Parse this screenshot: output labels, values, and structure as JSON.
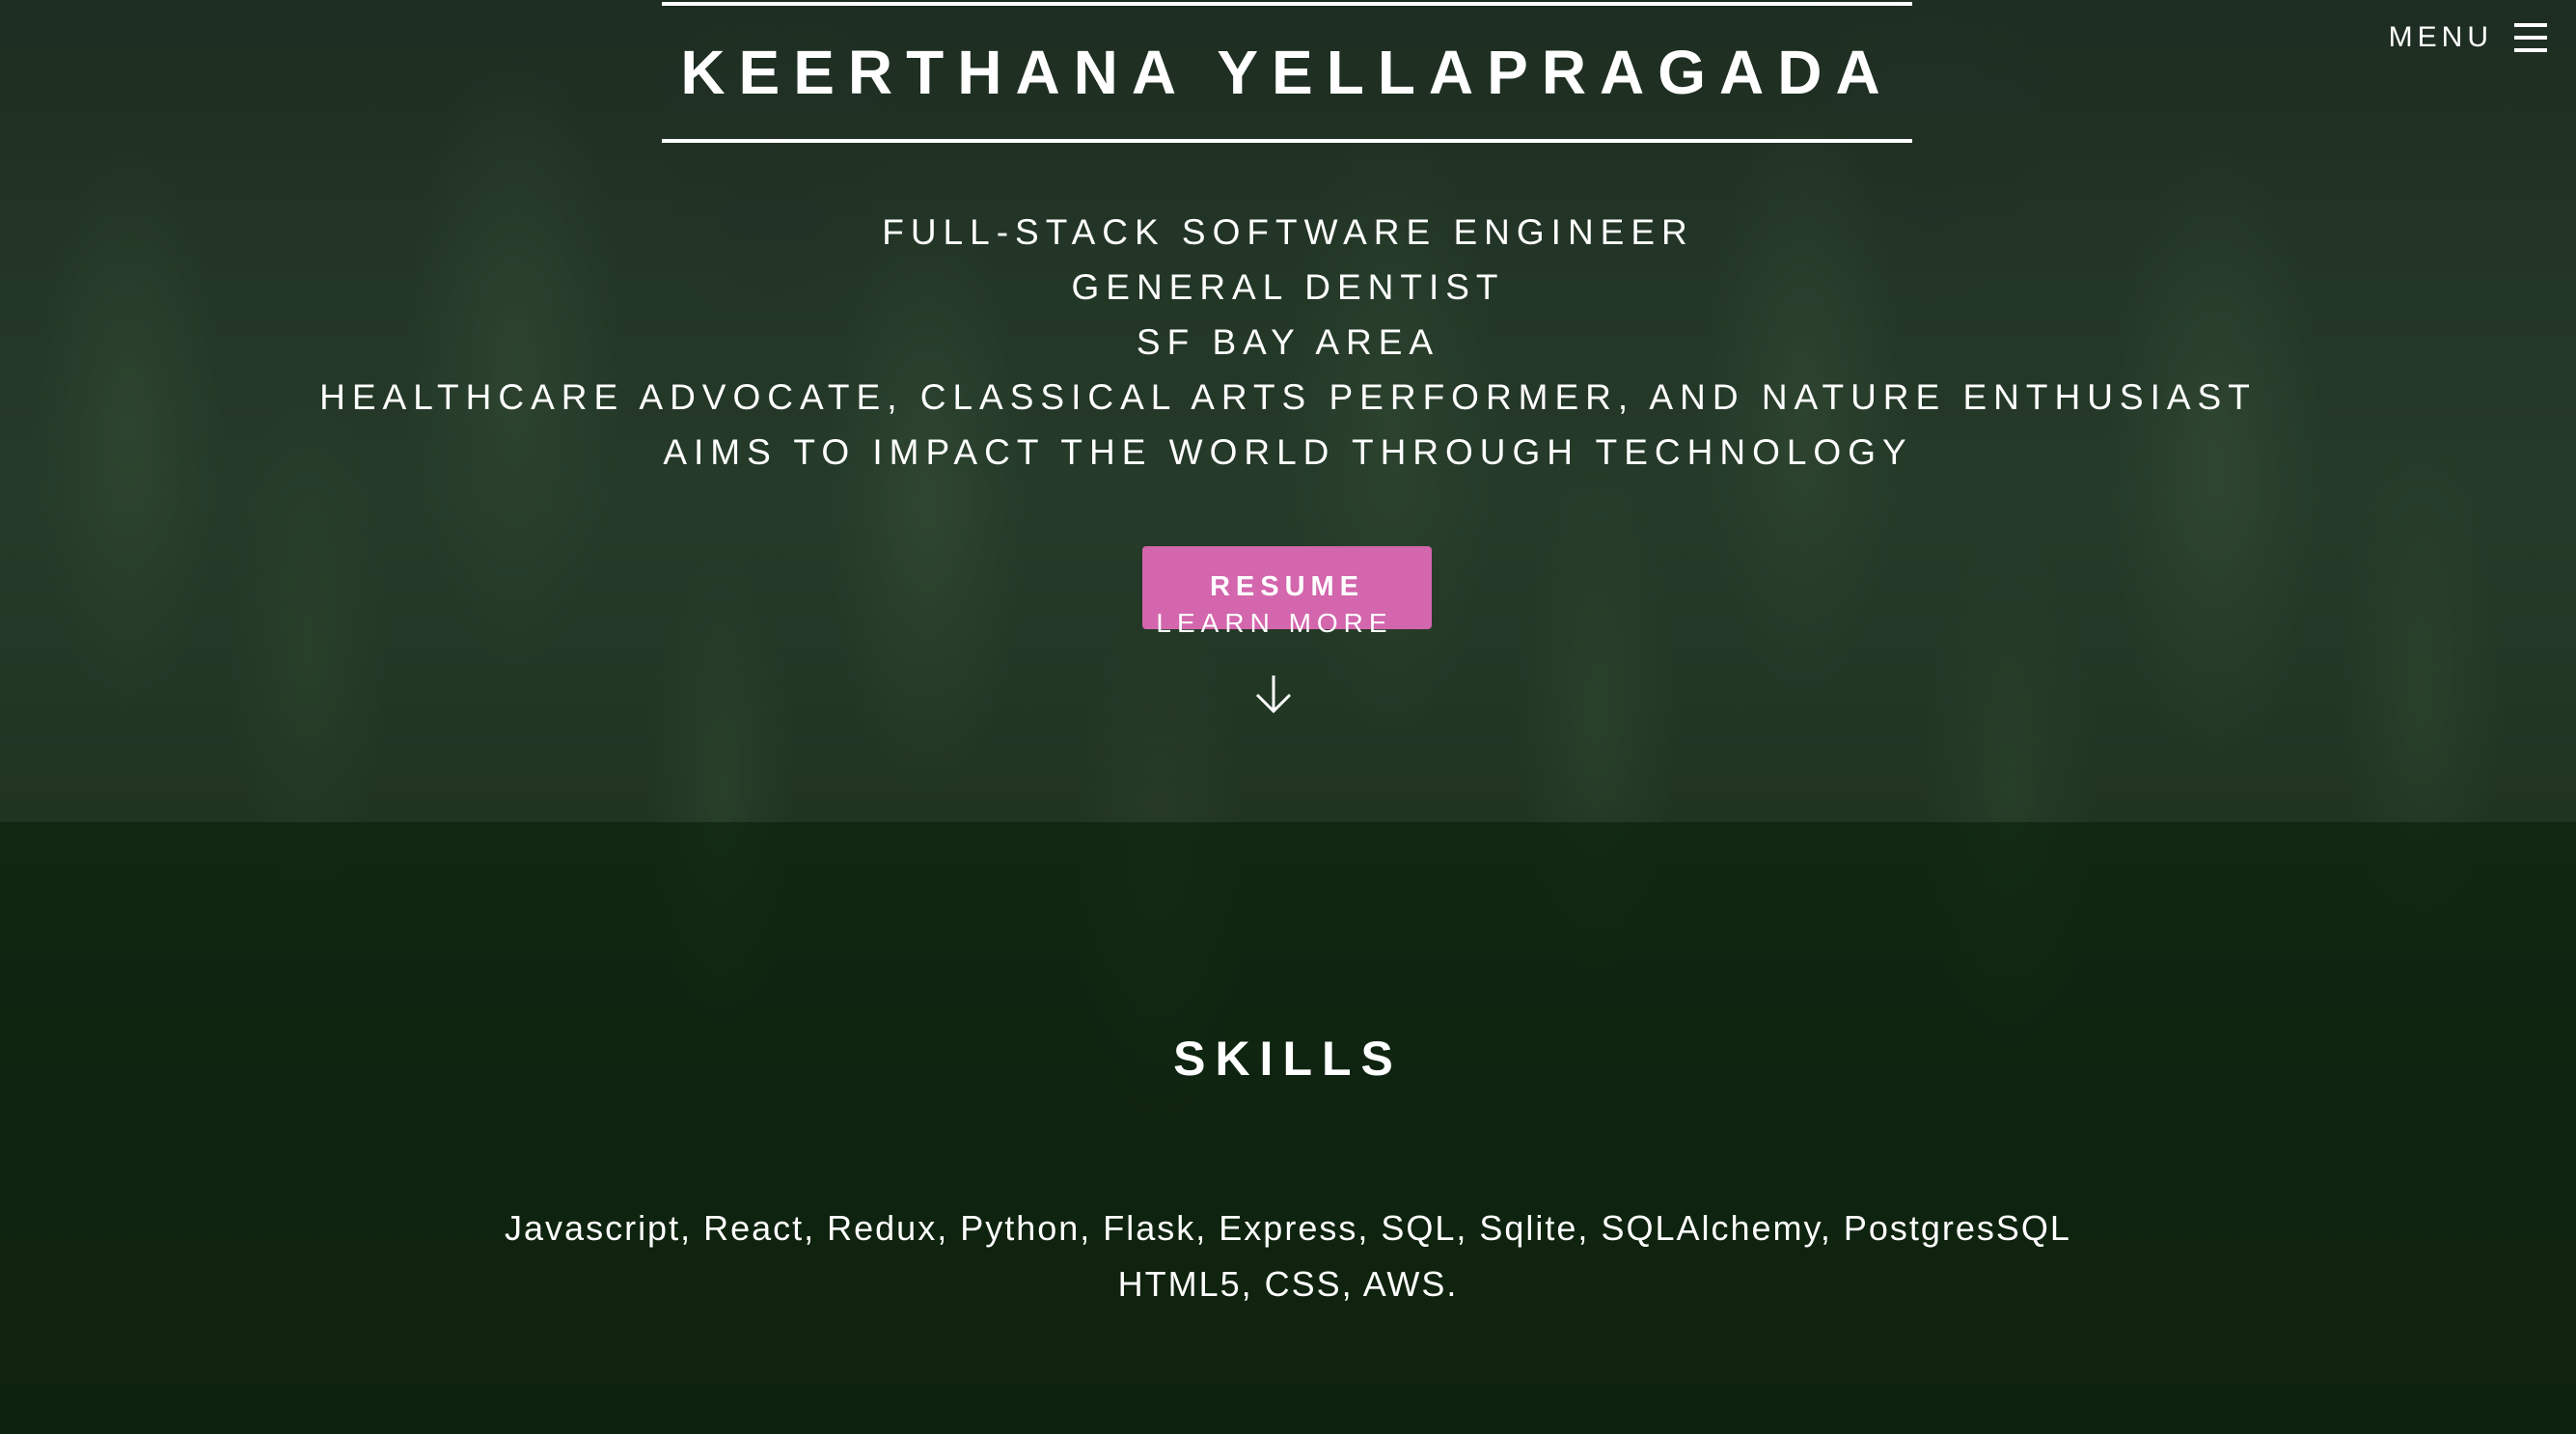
{
  "header": {
    "name": "KEERTHANA YELLAPRAGADA",
    "menu_label": "MENU",
    "menu_icon": "hamburger-menu-icon"
  },
  "intro": {
    "lines": [
      "FULL-STACK SOFTWARE ENGINEER",
      "GENERAL DENTIST",
      "SF BAY AREA",
      "HEALTHCARE ADVOCATE, CLASSICAL ARTS PERFORMER, AND NATURE ENTHUSIAST",
      "AIMS TO IMPACT THE WORLD THROUGH TECHNOLOGY"
    ]
  },
  "actions": {
    "resume_label": "RESUME",
    "learn_more_label": "LEARN MORE",
    "scroll_icon": "arrow-down-icon"
  },
  "skills": {
    "heading": "SKILLS",
    "lines": [
      "Javascript, React, Redux, Python, Flask, Express, SQL, Sqlite, SQLAlchemy, PostgresSQL",
      "HTML5, CSS, AWS."
    ]
  },
  "colors": {
    "accent_button": "#d366ad",
    "skills_band": "#0c200c",
    "text": "#ffffff"
  }
}
